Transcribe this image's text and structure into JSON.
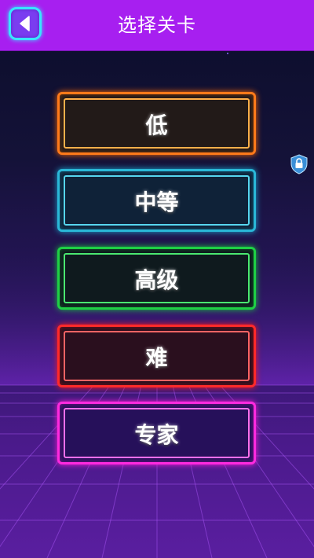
{
  "header": {
    "title": "选择关卡",
    "back_icon": "back-arrow-icon"
  },
  "levels": [
    {
      "label": "低",
      "color": "#ff7a1a"
    },
    {
      "label": "中等",
      "color": "#2ab8d8"
    },
    {
      "label": "高级",
      "color": "#1fd045"
    },
    {
      "label": "难",
      "color": "#ff2a2a"
    },
    {
      "label": "专家",
      "color": "#ff2adf"
    }
  ],
  "side_widget": {
    "icon": "lock-icon"
  },
  "colors": {
    "header_bg": "#a71ff0",
    "accent": "#38e6ff"
  }
}
